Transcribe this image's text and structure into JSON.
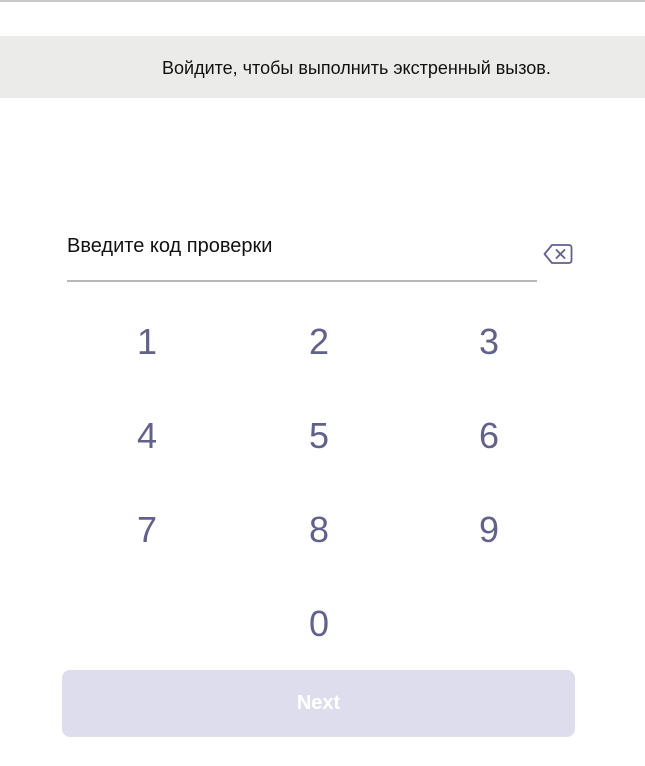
{
  "banner": {
    "message": "Войдите, чтобы выполнить экстренный вызов."
  },
  "code_field": {
    "placeholder": "Введите код проверки",
    "value": ""
  },
  "backspace": {
    "icon": "backspace-icon"
  },
  "keypad": {
    "keys": [
      "1",
      "2",
      "3",
      "4",
      "5",
      "6",
      "7",
      "8",
      "9",
      "0"
    ]
  },
  "next_button": {
    "label": "Next",
    "enabled": false
  },
  "colors": {
    "banner_bg": "#ebebe9",
    "key_text": "#61618a",
    "next_bg_disabled": "#dedded",
    "underline": "#b9b9bd"
  }
}
